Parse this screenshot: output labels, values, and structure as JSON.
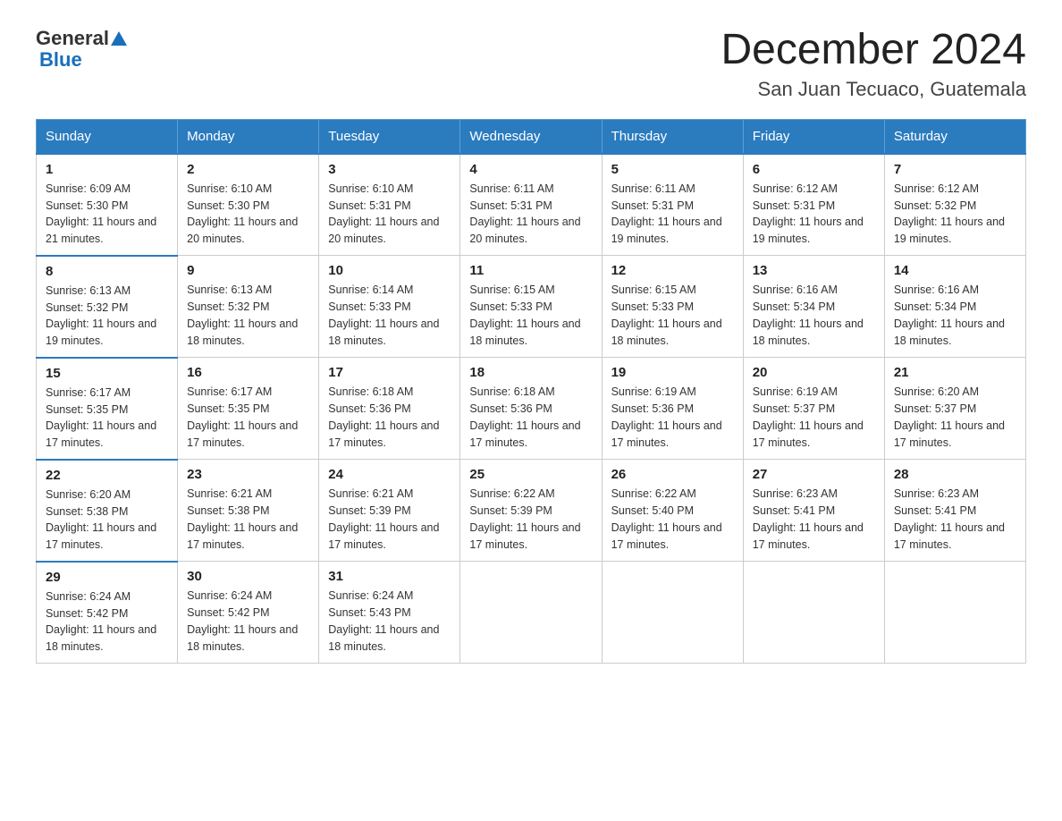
{
  "header": {
    "logo": {
      "general": "General",
      "blue": "Blue"
    },
    "title": "December 2024",
    "location": "San Juan Tecuaco, Guatemala"
  },
  "calendar": {
    "days_of_week": [
      "Sunday",
      "Monday",
      "Tuesday",
      "Wednesday",
      "Thursday",
      "Friday",
      "Saturday"
    ],
    "weeks": [
      [
        {
          "day": "1",
          "sunrise": "6:09 AM",
          "sunset": "5:30 PM",
          "daylight": "11 hours and 21 minutes."
        },
        {
          "day": "2",
          "sunrise": "6:10 AM",
          "sunset": "5:30 PM",
          "daylight": "11 hours and 20 minutes."
        },
        {
          "day": "3",
          "sunrise": "6:10 AM",
          "sunset": "5:31 PM",
          "daylight": "11 hours and 20 minutes."
        },
        {
          "day": "4",
          "sunrise": "6:11 AM",
          "sunset": "5:31 PM",
          "daylight": "11 hours and 20 minutes."
        },
        {
          "day": "5",
          "sunrise": "6:11 AM",
          "sunset": "5:31 PM",
          "daylight": "11 hours and 19 minutes."
        },
        {
          "day": "6",
          "sunrise": "6:12 AM",
          "sunset": "5:31 PM",
          "daylight": "11 hours and 19 minutes."
        },
        {
          "day": "7",
          "sunrise": "6:12 AM",
          "sunset": "5:32 PM",
          "daylight": "11 hours and 19 minutes."
        }
      ],
      [
        {
          "day": "8",
          "sunrise": "6:13 AM",
          "sunset": "5:32 PM",
          "daylight": "11 hours and 19 minutes."
        },
        {
          "day": "9",
          "sunrise": "6:13 AM",
          "sunset": "5:32 PM",
          "daylight": "11 hours and 18 minutes."
        },
        {
          "day": "10",
          "sunrise": "6:14 AM",
          "sunset": "5:33 PM",
          "daylight": "11 hours and 18 minutes."
        },
        {
          "day": "11",
          "sunrise": "6:15 AM",
          "sunset": "5:33 PM",
          "daylight": "11 hours and 18 minutes."
        },
        {
          "day": "12",
          "sunrise": "6:15 AM",
          "sunset": "5:33 PM",
          "daylight": "11 hours and 18 minutes."
        },
        {
          "day": "13",
          "sunrise": "6:16 AM",
          "sunset": "5:34 PM",
          "daylight": "11 hours and 18 minutes."
        },
        {
          "day": "14",
          "sunrise": "6:16 AM",
          "sunset": "5:34 PM",
          "daylight": "11 hours and 18 minutes."
        }
      ],
      [
        {
          "day": "15",
          "sunrise": "6:17 AM",
          "sunset": "5:35 PM",
          "daylight": "11 hours and 17 minutes."
        },
        {
          "day": "16",
          "sunrise": "6:17 AM",
          "sunset": "5:35 PM",
          "daylight": "11 hours and 17 minutes."
        },
        {
          "day": "17",
          "sunrise": "6:18 AM",
          "sunset": "5:36 PM",
          "daylight": "11 hours and 17 minutes."
        },
        {
          "day": "18",
          "sunrise": "6:18 AM",
          "sunset": "5:36 PM",
          "daylight": "11 hours and 17 minutes."
        },
        {
          "day": "19",
          "sunrise": "6:19 AM",
          "sunset": "5:36 PM",
          "daylight": "11 hours and 17 minutes."
        },
        {
          "day": "20",
          "sunrise": "6:19 AM",
          "sunset": "5:37 PM",
          "daylight": "11 hours and 17 minutes."
        },
        {
          "day": "21",
          "sunrise": "6:20 AM",
          "sunset": "5:37 PM",
          "daylight": "11 hours and 17 minutes."
        }
      ],
      [
        {
          "day": "22",
          "sunrise": "6:20 AM",
          "sunset": "5:38 PM",
          "daylight": "11 hours and 17 minutes."
        },
        {
          "day": "23",
          "sunrise": "6:21 AM",
          "sunset": "5:38 PM",
          "daylight": "11 hours and 17 minutes."
        },
        {
          "day": "24",
          "sunrise": "6:21 AM",
          "sunset": "5:39 PM",
          "daylight": "11 hours and 17 minutes."
        },
        {
          "day": "25",
          "sunrise": "6:22 AM",
          "sunset": "5:39 PM",
          "daylight": "11 hours and 17 minutes."
        },
        {
          "day": "26",
          "sunrise": "6:22 AM",
          "sunset": "5:40 PM",
          "daylight": "11 hours and 17 minutes."
        },
        {
          "day": "27",
          "sunrise": "6:23 AM",
          "sunset": "5:41 PM",
          "daylight": "11 hours and 17 minutes."
        },
        {
          "day": "28",
          "sunrise": "6:23 AM",
          "sunset": "5:41 PM",
          "daylight": "11 hours and 17 minutes."
        }
      ],
      [
        {
          "day": "29",
          "sunrise": "6:24 AM",
          "sunset": "5:42 PM",
          "daylight": "11 hours and 18 minutes."
        },
        {
          "day": "30",
          "sunrise": "6:24 AM",
          "sunset": "5:42 PM",
          "daylight": "11 hours and 18 minutes."
        },
        {
          "day": "31",
          "sunrise": "6:24 AM",
          "sunset": "5:43 PM",
          "daylight": "11 hours and 18 minutes."
        },
        null,
        null,
        null,
        null
      ]
    ]
  }
}
